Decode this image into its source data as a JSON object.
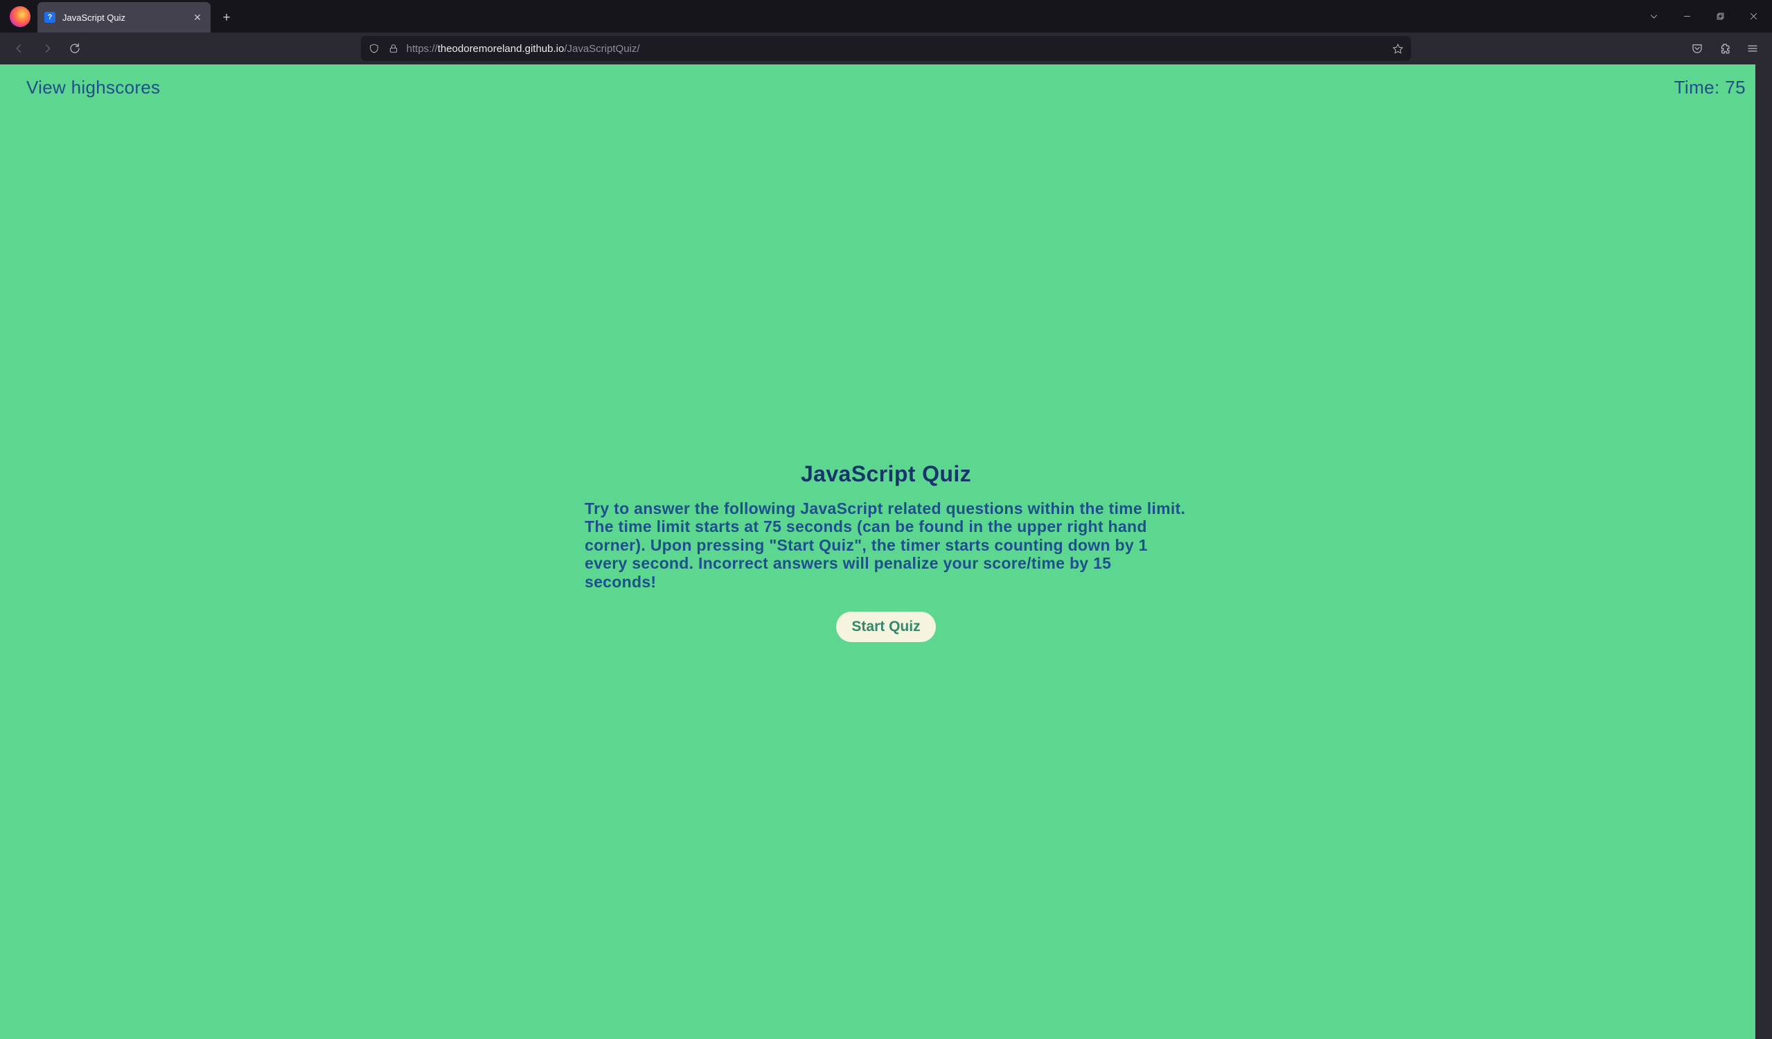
{
  "browser": {
    "tab_title": "JavaScript Quiz",
    "url_scheme": "https://",
    "url_domain": "theodoremoreland.github.io",
    "url_path": "/JavaScriptQuiz/"
  },
  "page": {
    "highscores_link": "View highscores",
    "timer_prefix": "Time: ",
    "timer_value": "75",
    "title": "JavaScript Quiz",
    "description": "Try to answer the following JavaScript related questions within the time limit. The time limit starts at 75 seconds (can be found in the upper right hand corner). Upon pressing \"Start Quiz\", the timer starts counting down by 1 every second. Incorrect answers will penalize your score/time by 15 seconds!",
    "start_button": "Start Quiz"
  }
}
